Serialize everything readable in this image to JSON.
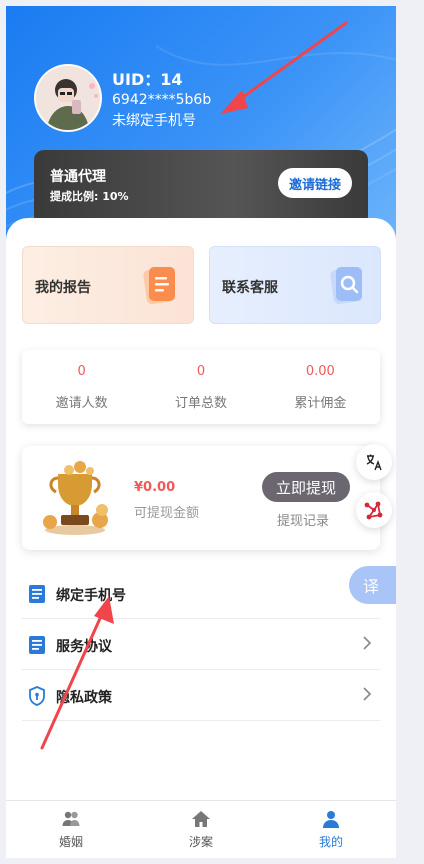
{
  "profile": {
    "uid": "UID：14",
    "address": "6942****5b6b",
    "phone_status": "未绑定手机号"
  },
  "agent": {
    "title": "普通代理",
    "ratio": "提成比例: 10%",
    "invite_label": "邀请链接"
  },
  "tiles": {
    "report": "我的报告",
    "service": "联系客服"
  },
  "stats": [
    {
      "value": "0",
      "label": "邀请人数"
    },
    {
      "value": "0",
      "label": "订单总数"
    },
    {
      "value": "0.00",
      "label": "累计佣金"
    }
  ],
  "wallet": {
    "amount": "¥0.00",
    "amount_label": "可提现金额",
    "withdraw_label": "立即提现",
    "records_label": "提现记录"
  },
  "floating": {
    "translate_tab": "译"
  },
  "menu": {
    "bind_phone": "绑定手机号",
    "agreement": "服务协议",
    "privacy": "隐私政策"
  },
  "tabs": [
    {
      "label": "婚姻"
    },
    {
      "label": "涉案"
    },
    {
      "label": "我的"
    }
  ],
  "colors": {
    "brand": "#1a7cf2",
    "accent_red": "#f05a5a",
    "active_tab": "#2a7bd9",
    "annotation_arrow": "#f0454b"
  }
}
